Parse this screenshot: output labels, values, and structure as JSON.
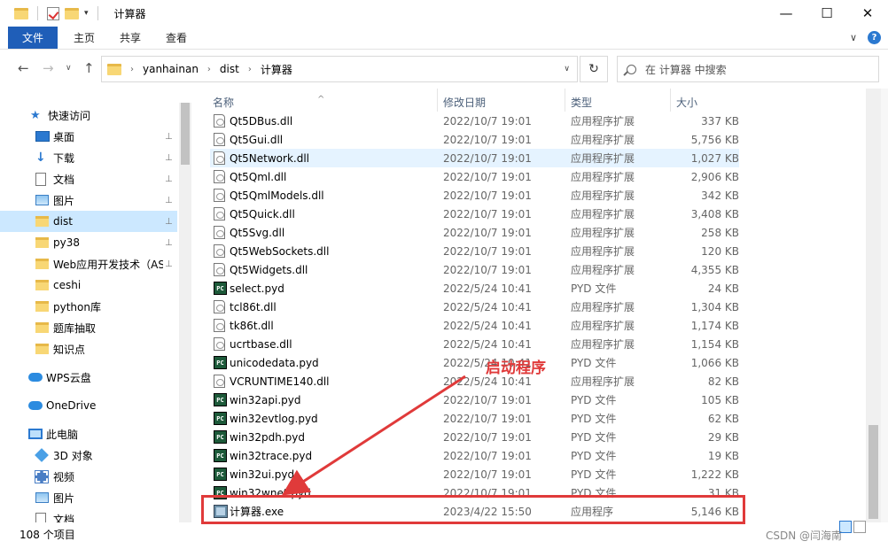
{
  "titlebar": {
    "title": "计算器",
    "controls": [
      "—",
      "☐",
      "✕"
    ]
  },
  "ribbon": {
    "tabs": [
      "文件",
      "主页",
      "共享",
      "查看"
    ],
    "expand_icon": "∨",
    "help_icon": "?"
  },
  "address": {
    "crumbs": [
      "yanhainan",
      "dist",
      "计算器"
    ],
    "search_placeholder": "在 计算器 中搜索"
  },
  "nav": {
    "items": [
      {
        "label": "快速访问",
        "icon": "star-icon",
        "pinned": false
      },
      {
        "label": "桌面",
        "icon": "desktop-icon",
        "pinned": true
      },
      {
        "label": "下载",
        "icon": "download-icon",
        "pinned": true
      },
      {
        "label": "文档",
        "icon": "document-icon",
        "pinned": true
      },
      {
        "label": "图片",
        "icon": "picture-icon",
        "pinned": true
      },
      {
        "label": "dist",
        "icon": "folder-icon",
        "pinned": true,
        "selected": true
      },
      {
        "label": "py38",
        "icon": "folder-icon",
        "pinned": true
      },
      {
        "label": "Web应用开发技术（AS",
        "icon": "folder-icon",
        "pinned": true
      },
      {
        "label": "ceshi",
        "icon": "folder-icon",
        "pinned": false
      },
      {
        "label": "python库",
        "icon": "folder-icon",
        "pinned": false
      },
      {
        "label": "题库抽取",
        "icon": "folder-icon",
        "pinned": false
      },
      {
        "label": "知识点",
        "icon": "folder-icon",
        "pinned": false
      },
      {
        "label": "WPS云盘",
        "icon": "cloud-icon",
        "pinned": false
      },
      {
        "label": "OneDrive",
        "icon": "cloud-icon",
        "pinned": false
      },
      {
        "label": "此电脑",
        "icon": "computer-icon",
        "pinned": false
      },
      {
        "label": "3D 对象",
        "icon": "3d-objects-icon",
        "pinned": false
      },
      {
        "label": "视频",
        "icon": "video-icon",
        "pinned": false
      },
      {
        "label": "图片",
        "icon": "picture-icon",
        "pinned": false
      },
      {
        "label": "文档",
        "icon": "document-icon",
        "pinned": false
      }
    ]
  },
  "columns": {
    "name": "名称",
    "date": "修改日期",
    "type": "类型",
    "size": "大小"
  },
  "files": [
    {
      "name": "Qt5DBus.dll",
      "date": "2022/10/7 19:01",
      "type": "应用程序扩展",
      "size": "337 KB",
      "kind": "dll"
    },
    {
      "name": "Qt5Gui.dll",
      "date": "2022/10/7 19:01",
      "type": "应用程序扩展",
      "size": "5,756 KB",
      "kind": "dll"
    },
    {
      "name": "Qt5Network.dll",
      "date": "2022/10/7 19:01",
      "type": "应用程序扩展",
      "size": "1,027 KB",
      "kind": "dll",
      "hover": true
    },
    {
      "name": "Qt5Qml.dll",
      "date": "2022/10/7 19:01",
      "type": "应用程序扩展",
      "size": "2,906 KB",
      "kind": "dll"
    },
    {
      "name": "Qt5QmlModels.dll",
      "date": "2022/10/7 19:01",
      "type": "应用程序扩展",
      "size": "342 KB",
      "kind": "dll"
    },
    {
      "name": "Qt5Quick.dll",
      "date": "2022/10/7 19:01",
      "type": "应用程序扩展",
      "size": "3,408 KB",
      "kind": "dll"
    },
    {
      "name": "Qt5Svg.dll",
      "date": "2022/10/7 19:01",
      "type": "应用程序扩展",
      "size": "258 KB",
      "kind": "dll"
    },
    {
      "name": "Qt5WebSockets.dll",
      "date": "2022/10/7 19:01",
      "type": "应用程序扩展",
      "size": "120 KB",
      "kind": "dll"
    },
    {
      "name": "Qt5Widgets.dll",
      "date": "2022/10/7 19:01",
      "type": "应用程序扩展",
      "size": "4,355 KB",
      "kind": "dll"
    },
    {
      "name": "select.pyd",
      "date": "2022/5/24 10:41",
      "type": "PYD 文件",
      "size": "24 KB",
      "kind": "pyd"
    },
    {
      "name": "tcl86t.dll",
      "date": "2022/5/24 10:41",
      "type": "应用程序扩展",
      "size": "1,304 KB",
      "kind": "dll"
    },
    {
      "name": "tk86t.dll",
      "date": "2022/5/24 10:41",
      "type": "应用程序扩展",
      "size": "1,174 KB",
      "kind": "dll"
    },
    {
      "name": "ucrtbase.dll",
      "date": "2022/5/24 10:41",
      "type": "应用程序扩展",
      "size": "1,154 KB",
      "kind": "dll"
    },
    {
      "name": "unicodedata.pyd",
      "date": "2022/5/24 10:41",
      "type": "PYD 文件",
      "size": "1,066 KB",
      "kind": "pyd"
    },
    {
      "name": "VCRUNTIME140.dll",
      "date": "2022/5/24 10:41",
      "type": "应用程序扩展",
      "size": "82 KB",
      "kind": "dll"
    },
    {
      "name": "win32api.pyd",
      "date": "2022/10/7 19:01",
      "type": "PYD 文件",
      "size": "105 KB",
      "kind": "pyd"
    },
    {
      "name": "win32evtlog.pyd",
      "date": "2022/10/7 19:01",
      "type": "PYD 文件",
      "size": "62 KB",
      "kind": "pyd"
    },
    {
      "name": "win32pdh.pyd",
      "date": "2022/10/7 19:01",
      "type": "PYD 文件",
      "size": "29 KB",
      "kind": "pyd"
    },
    {
      "name": "win32trace.pyd",
      "date": "2022/10/7 19:01",
      "type": "PYD 文件",
      "size": "19 KB",
      "kind": "pyd"
    },
    {
      "name": "win32ui.pyd",
      "date": "2022/10/7 19:01",
      "type": "PYD 文件",
      "size": "1,222 KB",
      "kind": "pyd"
    },
    {
      "name": "win32wnet.pyd",
      "date": "2022/10/7 19:01",
      "type": "PYD 文件",
      "size": "31 KB",
      "kind": "pyd"
    },
    {
      "name": "计算器.exe",
      "date": "2023/4/22 15:50",
      "type": "应用程序",
      "size": "5,146 KB",
      "kind": "exe"
    }
  ],
  "status": {
    "count": "108 个项目"
  },
  "annotation": {
    "text": "启动程序",
    "color": "#e03a3a"
  },
  "watermark": "CSDN @闫海南",
  "colors": {
    "accent": "#1f5eb8",
    "selection": "#cce8ff",
    "hover": "#e5f3ff"
  }
}
